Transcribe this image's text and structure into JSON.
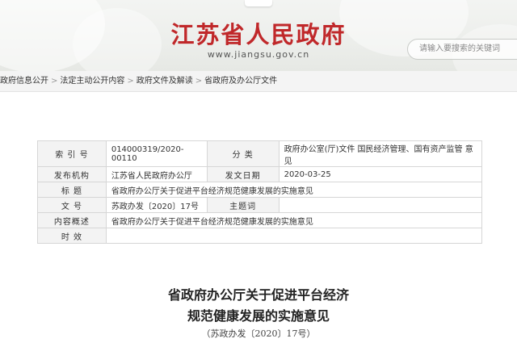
{
  "header": {
    "site_title": "江苏省人民政府",
    "site_url": "www.jiangsu.gov.cn",
    "search_placeholder": "请输入要搜索的关键词"
  },
  "breadcrumb": [
    "政府信息公开",
    "法定主动公开内容",
    "政府文件及解读",
    "省政府及办公厅文件"
  ],
  "info": {
    "index_label": "索 引 号",
    "index_value": "014000319/2020-00110",
    "category_label": "分 类",
    "category_value": "政府办公室(厅)文件 国民经济管理、国有资产监管 意见",
    "org_label": "发布机构",
    "org_value": "江苏省人民政府办公厅",
    "date_label": "发文日期",
    "date_value": "2020-03-25",
    "title_label": "标 题",
    "title_value": "省政府办公厅关于促进平台经济规范健康发展的实施意见",
    "docno_label": "文 号",
    "docno_value": "苏政办发〔2020〕17号",
    "subject_label": "主题词",
    "subject_value": "",
    "summary_label": "内容概述",
    "summary_value": "省政府办公厅关于促进平台经济规范健康发展的实施意见",
    "validity_label": "时 效",
    "validity_value": ""
  },
  "document": {
    "title_line1": "省政府办公厅关于促进平台经济",
    "title_line2": "规范健康发展的实施意见",
    "number": "（苏政办发〔2020〕17号）"
  }
}
